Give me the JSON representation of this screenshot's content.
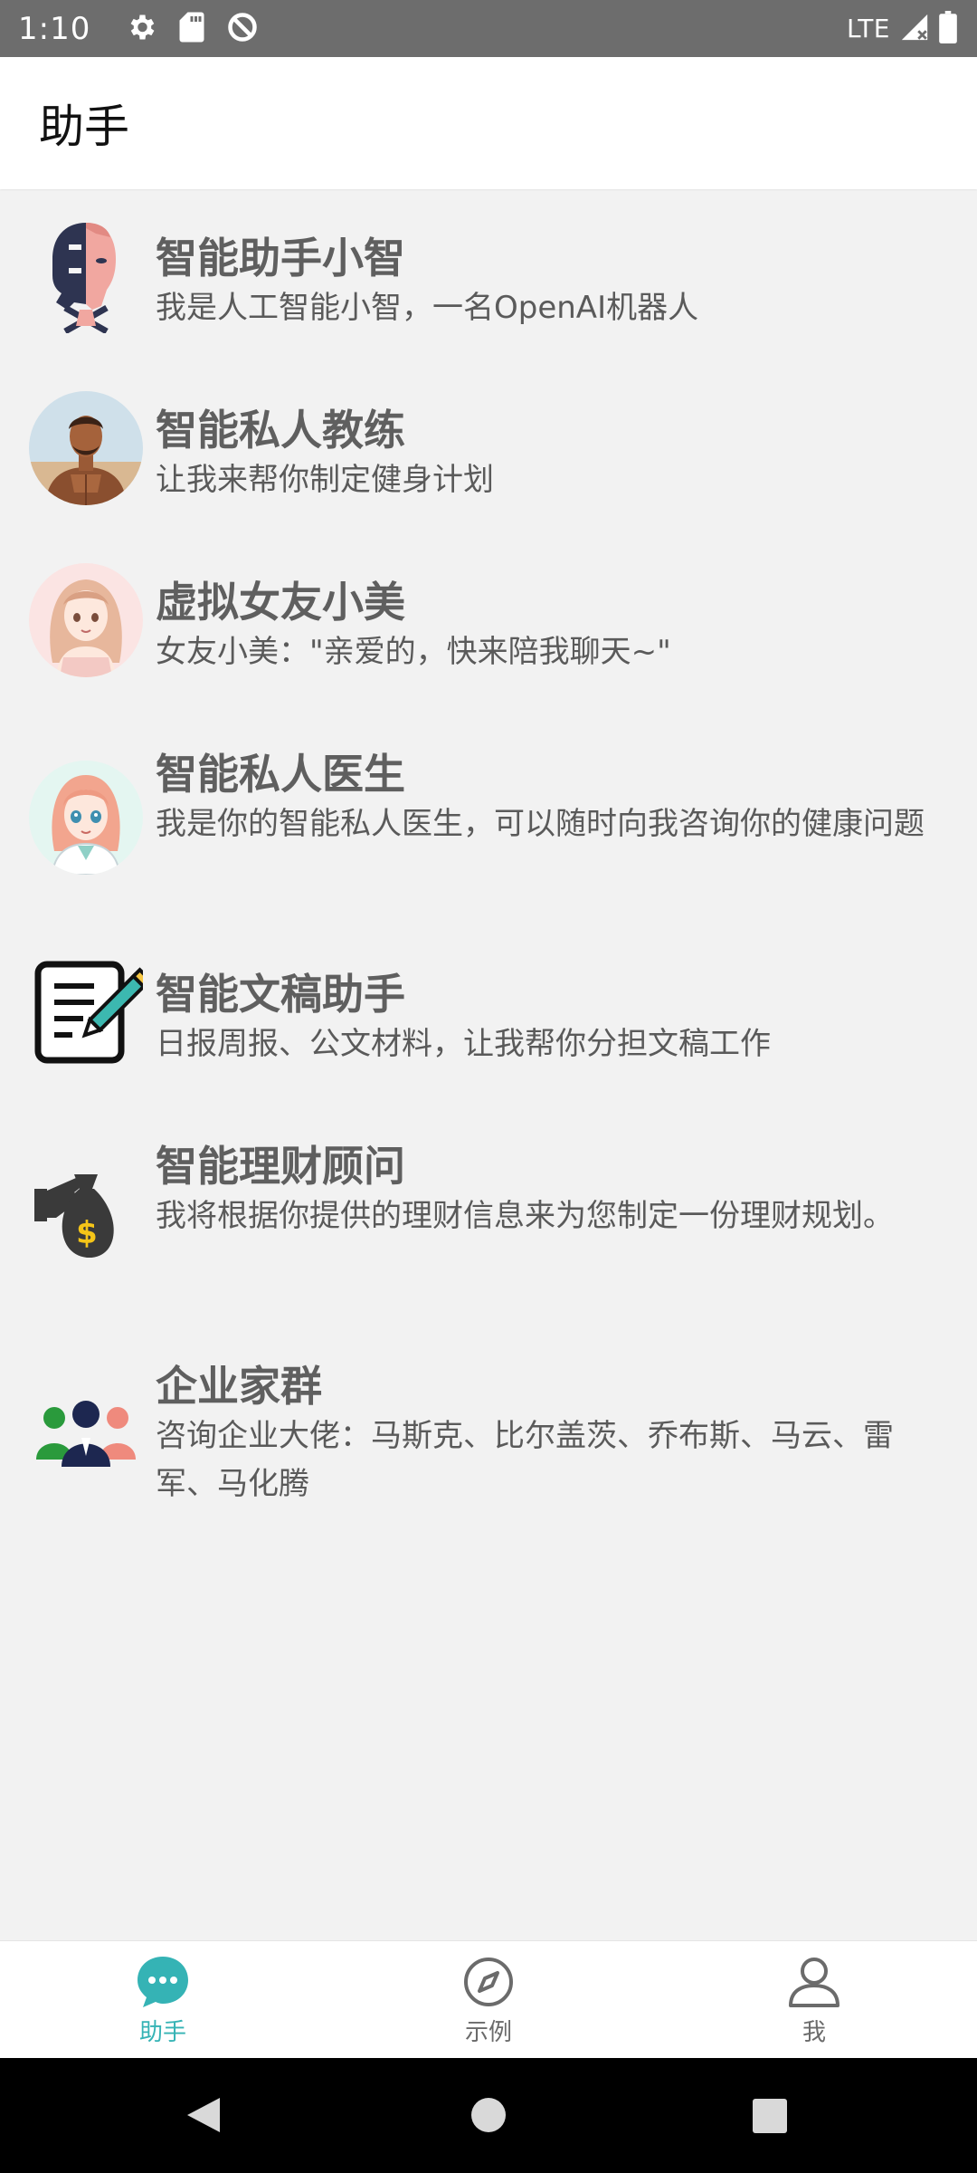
{
  "status_bar": {
    "time": "1:10",
    "network": "LTE",
    "icons": [
      "settings-icon",
      "sd-card-icon",
      "no-sync-icon",
      "signal-icon",
      "battery-icon"
    ]
  },
  "app_bar": {
    "title": "助手"
  },
  "assistants": [
    {
      "name": "智能助手小智",
      "desc": "我是人工智能小智，一名OpenAI机器人",
      "avatar": "robot-human-face-icon"
    },
    {
      "name": "智能私人教练",
      "desc": "让我来帮你制定健身计划",
      "avatar": "fitness-coach-avatar"
    },
    {
      "name": "虚拟女友小美",
      "desc": "女友小美：\"亲爱的，快来陪我聊天~\"",
      "avatar": "anime-girl-avatar"
    },
    {
      "name": "智能私人医生",
      "desc": "我是你的智能私人医生，可以随时向我咨询你的健康问题",
      "avatar": "anime-doctor-avatar"
    },
    {
      "name": "智能文稿助手",
      "desc": "日报周报、公文材料，让我帮你分担文稿工作",
      "avatar": "document-pencil-icon"
    },
    {
      "name": "智能理财顾问",
      "desc": "我将根据你提供的理财信息来为您制定一份理财规划。",
      "avatar": "money-bag-icon"
    },
    {
      "name": "企业家群",
      "desc": "咨询企业大佬：马斯克、比尔盖茨、乔布斯、马云、雷军、马化腾",
      "avatar": "group-people-icon"
    }
  ],
  "bottom_nav": {
    "items": [
      {
        "label": "助手",
        "icon": "chat-bubble-icon",
        "active": true
      },
      {
        "label": "示例",
        "icon": "compass-icon",
        "active": false
      },
      {
        "label": "我",
        "icon": "person-icon",
        "active": false
      }
    ],
    "active_color": "#35b3b5",
    "inactive_color": "#6b6b6b"
  },
  "system_nav": {
    "buttons": [
      "back-icon",
      "home-icon",
      "recents-icon"
    ]
  }
}
